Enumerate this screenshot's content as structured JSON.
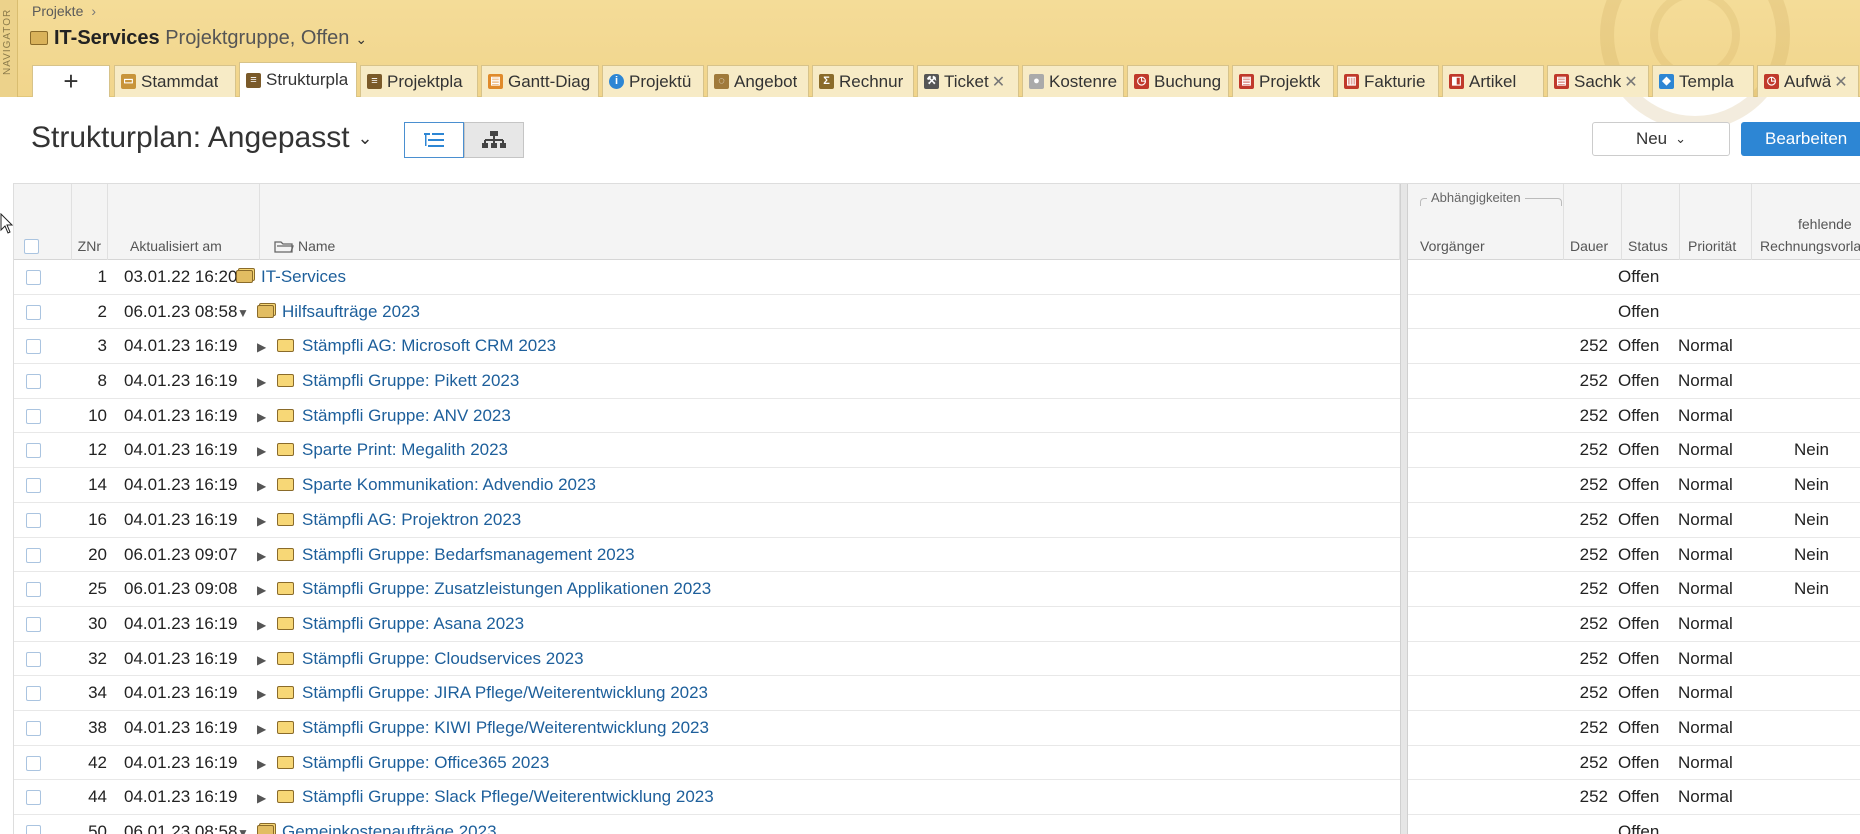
{
  "navigator_label": "NAVIGATOR",
  "breadcrumb": {
    "item": "Projekte",
    "sep": "›"
  },
  "project": {
    "name": "IT-Services",
    "subtitle": "Projektgruppe, Offen"
  },
  "tabs": [
    {
      "label": "Stammdat",
      "icon": "folder-icon",
      "color": "#c8943a",
      "closable": false
    },
    {
      "label": "Strukturpla",
      "icon": "tree-icon",
      "color": "#7a5a2a",
      "closable": false,
      "active": true
    },
    {
      "label": "Projektpla",
      "icon": "plan-icon",
      "color": "#7a5a2a",
      "closable": false
    },
    {
      "label": "Gantt-Diag",
      "icon": "gantt-icon",
      "color": "#e08a2a",
      "closable": false
    },
    {
      "label": "Projektü",
      "icon": "info-icon",
      "color": "#2d86d4",
      "closable": false
    },
    {
      "label": "Angebot",
      "icon": "offer-icon",
      "color": "#a07a3a",
      "closable": false
    },
    {
      "label": "Rechnur",
      "icon": "sum-icon",
      "color": "#8a6b2a",
      "closable": false
    },
    {
      "label": "Ticket",
      "icon": "tools-icon",
      "color": "#555555",
      "closable": true
    },
    {
      "label": "Kostenre",
      "icon": "circle-icon",
      "color": "#aaaaaa",
      "closable": false
    },
    {
      "label": "Buchung",
      "icon": "clock-icon",
      "color": "#c0392b",
      "closable": false
    },
    {
      "label": "Projektk",
      "icon": "doc-icon",
      "color": "#c0392b",
      "closable": false
    },
    {
      "label": "Fakturie",
      "icon": "chart-icon",
      "color": "#c0392b",
      "closable": false
    },
    {
      "label": "Artikel",
      "icon": "cube-icon",
      "color": "#c0392b",
      "closable": false
    },
    {
      "label": "Sachk",
      "icon": "doc-icon",
      "color": "#c0392b",
      "closable": true
    },
    {
      "label": "Templa",
      "icon": "template-icon",
      "color": "#2d86d4",
      "closable": false
    },
    {
      "label": "Aufwä",
      "icon": "clock-icon",
      "color": "#c0392b",
      "closable": true
    }
  ],
  "page": {
    "title": "Strukturplan: Angepasst",
    "btn_new": "Neu",
    "btn_edit": "Bearbeiten"
  },
  "table": {
    "headers": {
      "znr": "ZNr",
      "updated": "Aktualisiert am",
      "name": "Name",
      "group": "Abhängigkeiten",
      "pred": "Vorgänger",
      "dauer": "Dauer",
      "status": "Status",
      "prio": "Priorität",
      "fehl_1": "fehlende",
      "fehl_2": "Rechnungsvorla"
    },
    "rows": [
      {
        "nr": "1",
        "date": "03.01.22 16:20",
        "name": "IT-Services",
        "level": 0,
        "expander": "",
        "icon": "multi",
        "dauer": "",
        "status": "Offen",
        "prio": "",
        "fehl": ""
      },
      {
        "nr": "2",
        "date": "06.01.23 08:58",
        "name": "Hilfsaufträge 2023",
        "level": 0,
        "expander": "▼",
        "icon": "multi",
        "dauer": "",
        "status": "Offen",
        "prio": "",
        "fehl": ""
      },
      {
        "nr": "3",
        "date": "04.01.23 16:19",
        "name": "Stämpfli AG: Microsoft CRM 2023",
        "level": 1,
        "expander": "▶",
        "icon": "single",
        "dauer": "252",
        "status": "Offen",
        "prio": "Normal",
        "fehl": ""
      },
      {
        "nr": "8",
        "date": "04.01.23 16:19",
        "name": "Stämpfli Gruppe: Pikett 2023",
        "level": 1,
        "expander": "▶",
        "icon": "single",
        "dauer": "252",
        "status": "Offen",
        "prio": "Normal",
        "fehl": ""
      },
      {
        "nr": "10",
        "date": "04.01.23 16:19",
        "name": "Stämpfli Gruppe: ANV 2023",
        "level": 1,
        "expander": "▶",
        "icon": "single",
        "dauer": "252",
        "status": "Offen",
        "prio": "Normal",
        "fehl": ""
      },
      {
        "nr": "12",
        "date": "04.01.23 16:19",
        "name": "Sparte Print: Megalith 2023",
        "level": 1,
        "expander": "▶",
        "icon": "single",
        "dauer": "252",
        "status": "Offen",
        "prio": "Normal",
        "fehl": "Nein"
      },
      {
        "nr": "14",
        "date": "04.01.23 16:19",
        "name": "Sparte Kommunikation: Advendio 2023",
        "level": 1,
        "expander": "▶",
        "icon": "single",
        "dauer": "252",
        "status": "Offen",
        "prio": "Normal",
        "fehl": "Nein"
      },
      {
        "nr": "16",
        "date": "04.01.23 16:19",
        "name": "Stämpfli AG: Projektron 2023",
        "level": 1,
        "expander": "▶",
        "icon": "single",
        "dauer": "252",
        "status": "Offen",
        "prio": "Normal",
        "fehl": "Nein"
      },
      {
        "nr": "20",
        "date": "06.01.23 09:07",
        "name": "Stämpfli Gruppe: Bedarfsmanagement 2023",
        "level": 1,
        "expander": "▶",
        "icon": "single",
        "dauer": "252",
        "status": "Offen",
        "prio": "Normal",
        "fehl": "Nein"
      },
      {
        "nr": "25",
        "date": "06.01.23 09:08",
        "name": "Stämpfli Gruppe: Zusatzleistungen Applikationen 2023",
        "level": 1,
        "expander": "▶",
        "icon": "single",
        "dauer": "252",
        "status": "Offen",
        "prio": "Normal",
        "fehl": "Nein"
      },
      {
        "nr": "30",
        "date": "04.01.23 16:19",
        "name": "Stämpfli Gruppe: Asana 2023",
        "level": 1,
        "expander": "▶",
        "icon": "single",
        "dauer": "252",
        "status": "Offen",
        "prio": "Normal",
        "fehl": ""
      },
      {
        "nr": "32",
        "date": "04.01.23 16:19",
        "name": "Stämpfli Gruppe: Cloudservices 2023",
        "level": 1,
        "expander": "▶",
        "icon": "single",
        "dauer": "252",
        "status": "Offen",
        "prio": "Normal",
        "fehl": ""
      },
      {
        "nr": "34",
        "date": "04.01.23 16:19",
        "name": "Stämpfli Gruppe: JIRA Pflege/Weiterentwicklung 2023",
        "level": 1,
        "expander": "▶",
        "icon": "single",
        "dauer": "252",
        "status": "Offen",
        "prio": "Normal",
        "fehl": ""
      },
      {
        "nr": "38",
        "date": "04.01.23 16:19",
        "name": "Stämpfli Gruppe: KIWI Pflege/Weiterentwicklung 2023",
        "level": 1,
        "expander": "▶",
        "icon": "single",
        "dauer": "252",
        "status": "Offen",
        "prio": "Normal",
        "fehl": ""
      },
      {
        "nr": "42",
        "date": "04.01.23 16:19",
        "name": "Stämpfli Gruppe: Office365 2023",
        "level": 1,
        "expander": "▶",
        "icon": "single",
        "dauer": "252",
        "status": "Offen",
        "prio": "Normal",
        "fehl": ""
      },
      {
        "nr": "44",
        "date": "04.01.23 16:19",
        "name": "Stämpfli Gruppe: Slack Pflege/Weiterentwicklung 2023",
        "level": 1,
        "expander": "▶",
        "icon": "single",
        "dauer": "252",
        "status": "Offen",
        "prio": "Normal",
        "fehl": ""
      },
      {
        "nr": "50",
        "date": "06.01.23 08:58",
        "name": "Gemeinkostenaufträge 2023",
        "level": 0,
        "expander": "▼",
        "icon": "multi",
        "dauer": "",
        "status": "Offen",
        "prio": "",
        "fehl": ""
      }
    ]
  }
}
